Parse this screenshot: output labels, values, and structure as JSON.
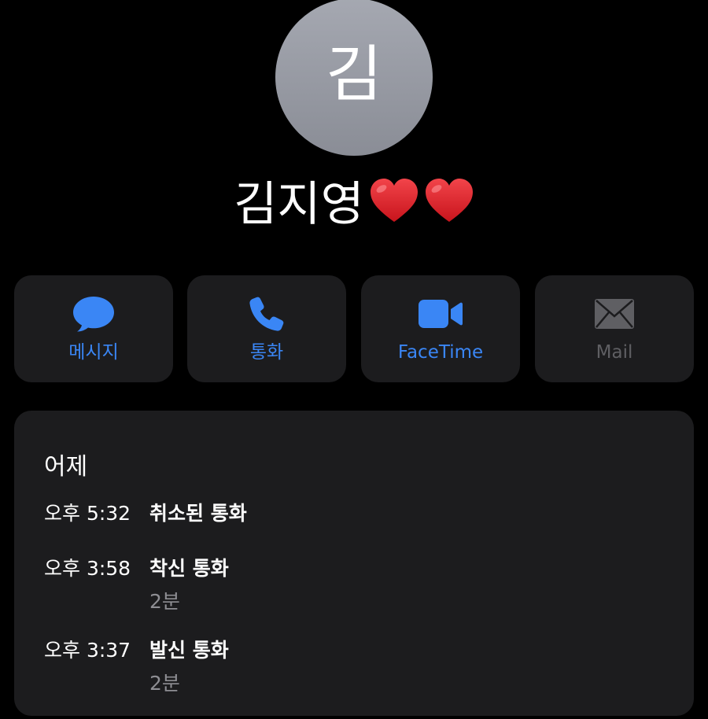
{
  "contact": {
    "initial": "김",
    "name": "김지영",
    "name_emoji": [
      "heart",
      "heart"
    ]
  },
  "actions": [
    {
      "label": "메시지",
      "icon": "message-bubble-icon",
      "enabled": true
    },
    {
      "label": "통화",
      "icon": "phone-icon",
      "enabled": true
    },
    {
      "label": "FaceTime",
      "icon": "video-camera-icon",
      "enabled": true
    },
    {
      "label": "Mail",
      "icon": "envelope-icon",
      "enabled": false
    }
  ],
  "history": {
    "date": "어제",
    "calls": [
      {
        "time": "오후 5:32",
        "type": "취소된 통화",
        "duration": ""
      },
      {
        "time": "오후 3:58",
        "type": "착신 통화",
        "duration": "2분"
      },
      {
        "time": "오후 3:37",
        "type": "발신 통화",
        "duration": "2분"
      }
    ]
  },
  "colors": {
    "background": "#000000",
    "card": "#1c1c1e",
    "accent": "#3a86f5",
    "disabled": "#5f5f63",
    "secondary_text": "#8e8e93",
    "heart": "#e0242b"
  }
}
